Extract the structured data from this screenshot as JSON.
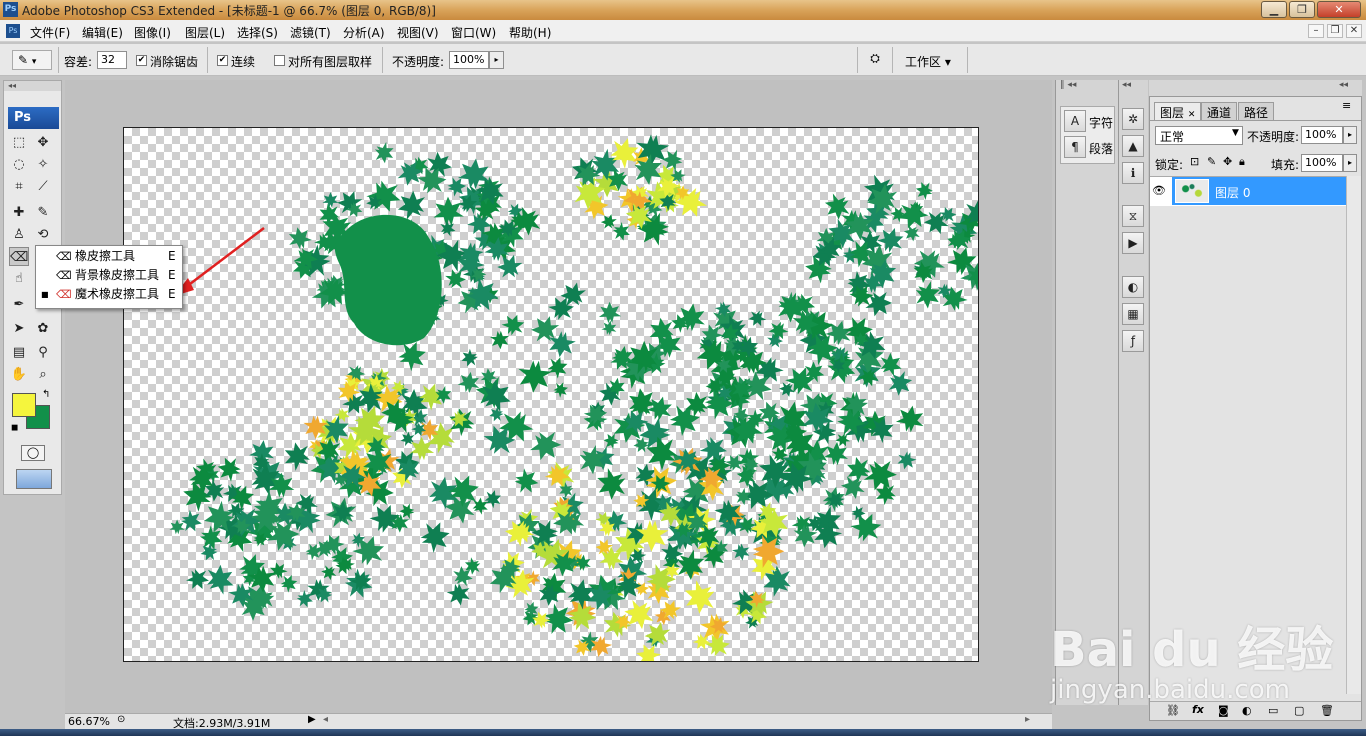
{
  "window": {
    "title": "Adobe Photoshop CS3 Extended - [未标题-1 @ 66.7% (图层 0, RGB/8)]",
    "ps_badge": "Ps",
    "minimize": "▁",
    "maximize": "❐",
    "close": "✕"
  },
  "menu": {
    "items": [
      "文件(F)",
      "编辑(E)",
      "图像(I)",
      "图层(L)",
      "选择(S)",
      "滤镜(T)",
      "分析(A)",
      "视图(V)",
      "窗口(W)",
      "帮助(H)"
    ],
    "doc_min": "–",
    "doc_restore": "❐",
    "doc_close": "✕"
  },
  "options": {
    "tolerance_label": "容差:",
    "tolerance_value": "32",
    "antialias_label": "消除锯齿",
    "antialias_checked": true,
    "contiguous_label": "连续",
    "contiguous_checked": true,
    "sample_all_label": "对所有图层取样",
    "sample_all_checked": false,
    "opacity_label": "不透明度:",
    "opacity_value": "100%",
    "workspace_label": "工作区 ▾"
  },
  "toolbox": {
    "logo": "Ps",
    "fg_color": "#f5f53d",
    "bg_color": "#12904a"
  },
  "flyout": {
    "items": [
      {
        "label": "橡皮擦工具",
        "shortcut": "E",
        "selected": false
      },
      {
        "label": "背景橡皮擦工具",
        "shortcut": "E",
        "selected": false
      },
      {
        "label": "魔术橡皮擦工具",
        "shortcut": "E",
        "selected": true
      }
    ]
  },
  "statusbar": {
    "zoom": "66.67%",
    "doc_info": "文档:2.93M/3.91M"
  },
  "dock": {
    "character": "字符",
    "paragraph": "段落"
  },
  "layers": {
    "tabs": [
      "图层",
      "通道",
      "路径"
    ],
    "blend_mode": "正常",
    "opacity_label": "不透明度:",
    "opacity_value": "100%",
    "lock_label": "锁定:",
    "fill_label": "填充:",
    "fill_value": "100%",
    "layer_name": "图层 0"
  },
  "watermark": {
    "brand": "Bai du 经验",
    "url": "jingyan.baidu.com"
  },
  "colors": {
    "accent": "#3399ff",
    "leaf_green": "#12904a",
    "leaf_yellow": "#e9f03a",
    "arrow_red": "#e02020"
  }
}
